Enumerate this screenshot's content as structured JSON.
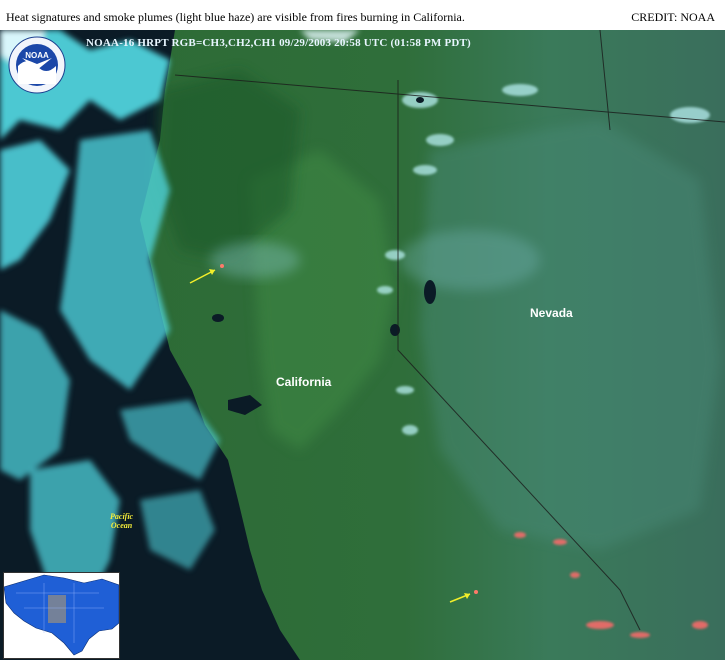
{
  "caption": "Heat signatures and smoke plumes (light blue haze) are visible from fires burning in California.",
  "credit": "CREDIT: NOAA",
  "image_header": "NOAA-16  HRPT  RGB=CH3,CH2,CH1  09/29/2003  20:58 UTC (01:58 PM PDT)",
  "logo": {
    "text": "NOAA",
    "icon": "noaa-logo-icon"
  },
  "labels": {
    "california": "California",
    "nevada": "Nevada",
    "ocean_line1": "Pacific",
    "ocean_line2": "Ocean"
  },
  "colors": {
    "ocean": "#0a1a26",
    "land": "#2f6b3c",
    "cloud": "#5fe0ea",
    "fire_arrow": "#f2ee2a",
    "burn_scar": "#ff6a6a"
  }
}
